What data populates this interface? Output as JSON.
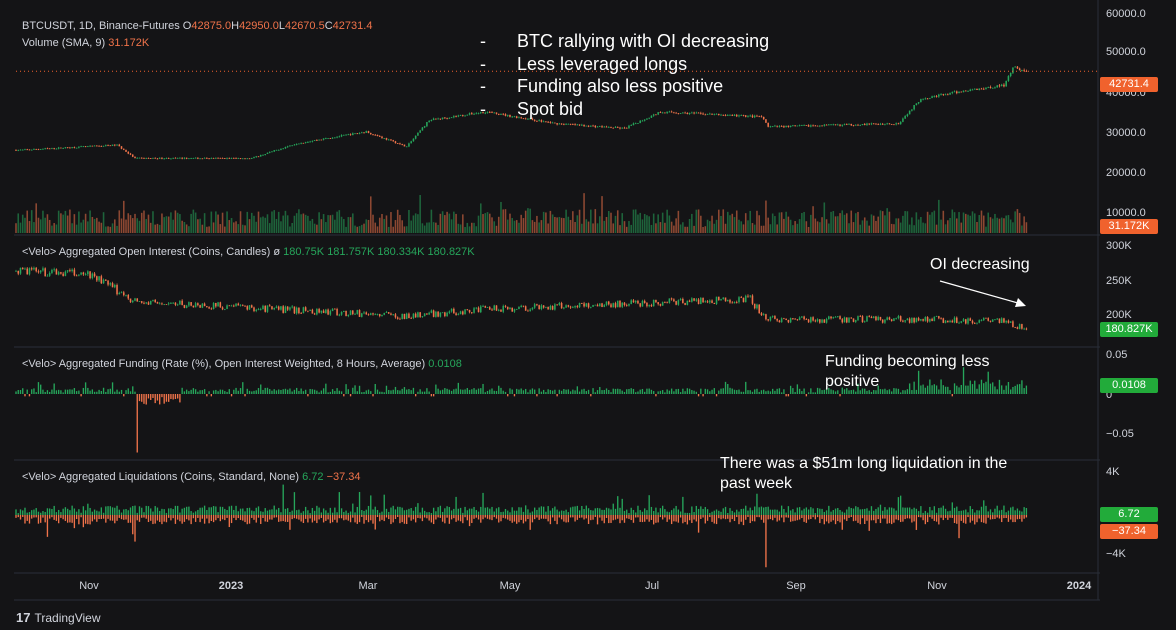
{
  "panes": {
    "price": {
      "symbol": "BTCUSDT, 1D, Binance-Futures",
      "ohlc": [
        {
          "key": "O",
          "value": "42875.0"
        },
        {
          "key": "H",
          "value": "42950.0"
        },
        {
          "key": "L",
          "value": "42670.5"
        },
        {
          "key": "C",
          "value": "42731.4"
        }
      ],
      "volume_label": "Volume (SMA, 9)",
      "volume_value": "31.172K",
      "price_tag": "42731.4",
      "volume_tag": "31.172K",
      "y_ticks": [
        "60000.0",
        "50000.0",
        "40000.0",
        "30000.0",
        "20000.0",
        "10000.0"
      ]
    },
    "open_interest": {
      "title": "<Velo> Aggregated Open Interest (Coins, Candles)",
      "symbol": "ø",
      "values": [
        "180.75K",
        "181.757K",
        "180.334K",
        "180.827K"
      ],
      "tag": "180.827K",
      "y_ticks": [
        "300K",
        "250K",
        "200K"
      ]
    },
    "funding": {
      "title": "<Velo> Aggregated Funding (Rate (%), Open Interest Weighted, 8 Hours, Average)",
      "value": "0.0108",
      "tag": "0.0108",
      "y_ticks": [
        "0.05",
        "0",
        "−0.05"
      ]
    },
    "liquidations": {
      "title": "<Velo> Aggregated Liquidations (Coins, Standard, None)",
      "value_pos": "6.72",
      "value_neg": "−37.34",
      "tag_pos": "6.72",
      "tag_neg": "−37.34",
      "y_ticks": [
        "4K",
        "−4K"
      ]
    }
  },
  "annotations": {
    "bullets": [
      "BTC rallying with OI decreasing",
      "Less leveraged longs",
      "Funding also less positive",
      "Spot bid"
    ],
    "bullet_marker": "-",
    "oi_note": "OI decreasing",
    "funding_note_1": "Funding becoming less",
    "funding_note_2": "positive",
    "liq_note_1": "There was a $51m long liquidation in the",
    "liq_note_2": "past week"
  },
  "x_axis": {
    "labels": [
      {
        "text": "Nov",
        "bold": false
      },
      {
        "text": "2023",
        "bold": true
      },
      {
        "text": "Mar",
        "bold": false
      },
      {
        "text": "May",
        "bold": false
      },
      {
        "text": "Jul",
        "bold": false
      },
      {
        "text": "Sep",
        "bold": false
      },
      {
        "text": "Nov",
        "bold": false
      },
      {
        "text": "2024",
        "bold": true
      }
    ]
  },
  "branding": {
    "name": "TradingView"
  },
  "colors": {
    "background": "#141416",
    "up": "#26a65b",
    "down": "#f0734a",
    "price_tag": "#f0622d",
    "green_tag": "#22ab3a",
    "text": "#d1d4dc"
  },
  "chart_data": [
    {
      "type": "candlestick",
      "name": "BTCUSDT, 1D, Binance-Futures",
      "x_range": [
        "2022-09-17",
        "2024-01-11"
      ],
      "ylim": [
        0,
        60000
      ],
      "key_points": [
        {
          "date": "2022-09-20",
          "close": 19000
        },
        {
          "date": "2022-11-01",
          "close": 20500
        },
        {
          "date": "2022-11-09",
          "close": 16500
        },
        {
          "date": "2022-12-31",
          "close": 16500
        },
        {
          "date": "2023-01-20",
          "close": 21000
        },
        {
          "date": "2023-02-20",
          "close": 24500
        },
        {
          "date": "2023-03-10",
          "close": 20000
        },
        {
          "date": "2023-03-20",
          "close": 28000
        },
        {
          "date": "2023-04-14",
          "close": 30500
        },
        {
          "date": "2023-05-15",
          "close": 27000
        },
        {
          "date": "2023-06-15",
          "close": 25500
        },
        {
          "date": "2023-07-01",
          "close": 30500
        },
        {
          "date": "2023-08-15",
          "close": 29000
        },
        {
          "date": "2023-08-18",
          "close": 26000
        },
        {
          "date": "2023-10-15",
          "close": 27000
        },
        {
          "date": "2023-10-25",
          "close": 34500
        },
        {
          "date": "2023-11-15",
          "close": 37000
        },
        {
          "date": "2023-12-01",
          "close": 38500
        },
        {
          "date": "2023-12-05",
          "close": 44000
        },
        {
          "date": "2023-12-11",
          "close": 42731.4
        }
      ],
      "last": {
        "open": 42875.0,
        "high": 42950.0,
        "low": 42670.5,
        "close": 42731.4
      }
    },
    {
      "type": "bar",
      "name": "Volume (SMA, 9)",
      "last": 31172
    },
    {
      "type": "candlestick",
      "name": "<Velo> Aggregated Open Interest (Coins, Candles)",
      "ylim": [
        150000,
        300000
      ],
      "key_points": [
        {
          "date": "2022-09-20",
          "close": 265000
        },
        {
          "date": "2022-10-20",
          "close": 260000
        },
        {
          "date": "2022-11-10",
          "close": 220000
        },
        {
          "date": "2023-01-01",
          "close": 212000
        },
        {
          "date": "2023-03-10",
          "close": 200000
        },
        {
          "date": "2023-04-15",
          "close": 210000
        },
        {
          "date": "2023-06-15",
          "close": 218000
        },
        {
          "date": "2023-08-10",
          "close": 225000
        },
        {
          "date": "2023-08-17",
          "close": 195000
        },
        {
          "date": "2023-11-01",
          "close": 195000
        },
        {
          "date": "2023-12-01",
          "close": 192000
        },
        {
          "date": "2023-12-11",
          "close": 180827
        }
      ],
      "last": {
        "open": 180750,
        "high": 181757,
        "low": 180334,
        "close": 180827
      }
    },
    {
      "type": "bar",
      "name": "<Velo> Aggregated Funding (Rate (%), Open Interest Weighted, 8 Hours, Average)",
      "ylim": [
        -0.1,
        0.06
      ],
      "key_points": [
        {
          "date": "2022-11-10",
          "value": -0.075
        },
        {
          "date": "2023-01-15",
          "value": 0.012
        },
        {
          "date": "2023-10-30",
          "value": 0.018
        },
        {
          "date": "2023-12-05",
          "value": 0.028
        },
        {
          "date": "2023-12-11",
          "value": 0.0108
        }
      ],
      "last": 0.0108
    },
    {
      "type": "bar",
      "name": "<Velo> Aggregated Liquidations (Coins, Standard, None)",
      "ylim": [
        -6000,
        5000
      ],
      "key_points": [
        {
          "date": "2022-11-09",
          "value": -2800
        },
        {
          "date": "2023-01-14",
          "value": 3200
        },
        {
          "date": "2023-08-17",
          "value": -5500
        },
        {
          "date": "2023-12-11",
          "value_long": 6.72,
          "value_short": -37.34
        }
      ],
      "last_pos": 6.72,
      "last_neg": -37.34
    }
  ]
}
